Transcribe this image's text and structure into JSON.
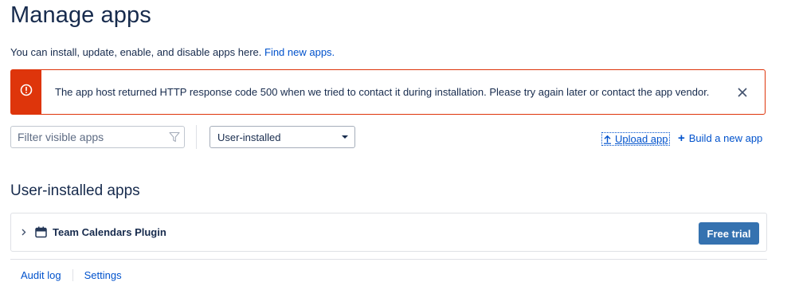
{
  "page": {
    "title": "Manage apps",
    "intro_text": "You can install, update, enable, and disable apps here.",
    "intro_link": "Find new apps."
  },
  "error": {
    "message": "The app host returned HTTP response code 500 when we tried to contact it during installation. Please try again later or contact the app vendor.",
    "icon": "error-icon",
    "color": "#de350b"
  },
  "toolbar": {
    "filter_placeholder": "Filter visible apps",
    "filter_icon": "funnel-icon",
    "select_value": "User-installed",
    "upload_label": "Upload app",
    "build_label": "Build a new app"
  },
  "section": {
    "title": "User-installed apps"
  },
  "apps": [
    {
      "name": "Team Calendars Plugin",
      "action": "Free trial",
      "icon": "calendar-icon"
    }
  ],
  "footer": {
    "audit_log": "Audit log",
    "settings": "Settings"
  },
  "colors": {
    "link": "#0052cc",
    "primary_button": "#3572b0",
    "text": "#172b4d"
  }
}
